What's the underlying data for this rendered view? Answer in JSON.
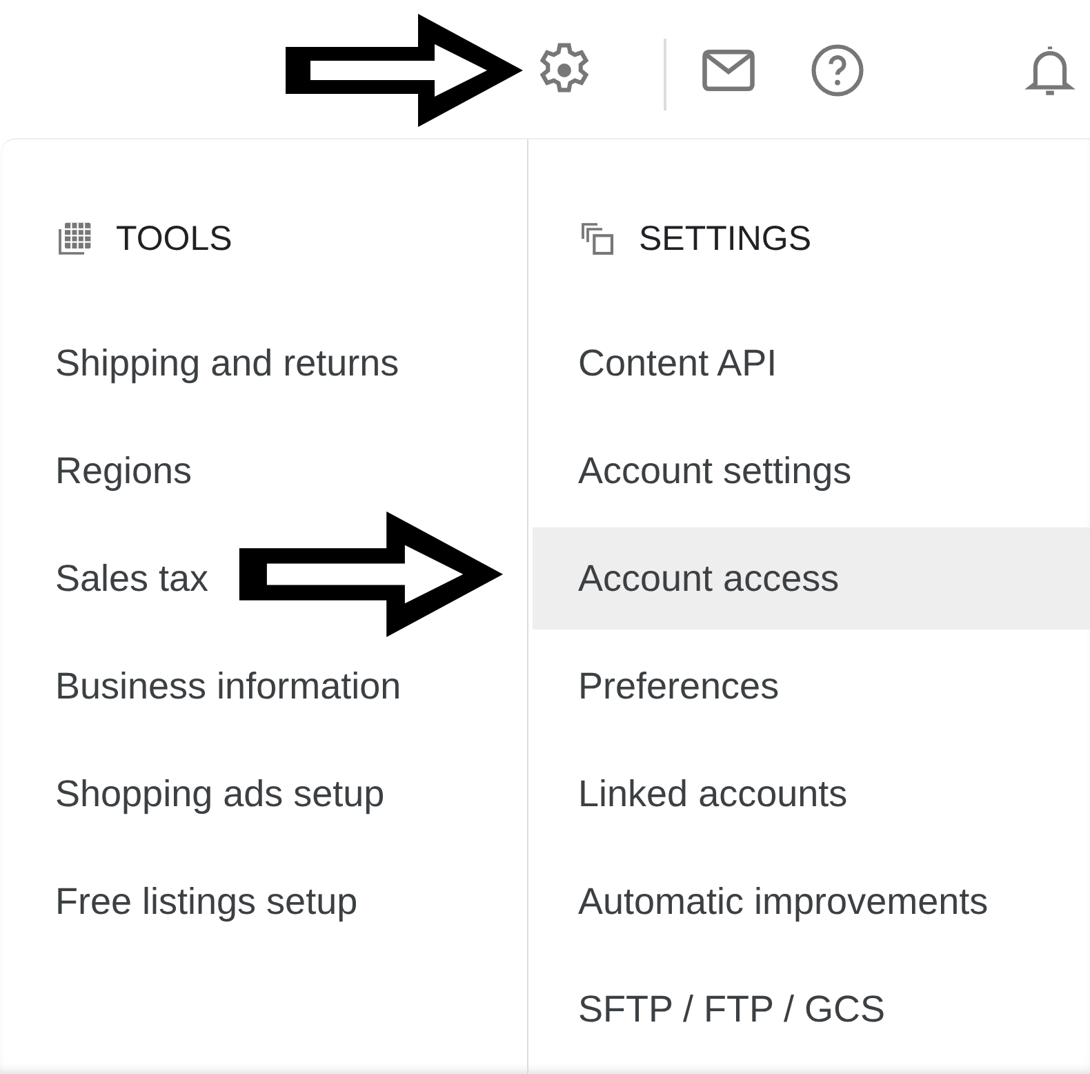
{
  "toolbar": {
    "icons": [
      {
        "kind": "gear"
      },
      {
        "kind": "divider"
      },
      {
        "kind": "mail"
      },
      {
        "kind": "help"
      },
      {
        "kind": "bell"
      }
    ]
  },
  "menu": {
    "sections": [
      {
        "kind": "tools",
        "title": "TOOLS",
        "items": [
          {
            "label": "Shipping and returns",
            "selected": false
          },
          {
            "label": "Regions",
            "selected": false
          },
          {
            "label": "Sales tax",
            "selected": false
          },
          {
            "label": "Business information",
            "selected": false
          },
          {
            "label": "Shopping ads setup",
            "selected": false
          },
          {
            "label": "Free listings setup",
            "selected": false
          }
        ]
      },
      {
        "kind": "settings",
        "title": "SETTINGS",
        "items": [
          {
            "label": "Content API",
            "selected": false
          },
          {
            "label": "Account settings",
            "selected": false
          },
          {
            "label": "Account access",
            "selected": true
          },
          {
            "label": "Preferences",
            "selected": false
          },
          {
            "label": "Linked accounts",
            "selected": false
          },
          {
            "label": "Automatic improvements",
            "selected": false
          },
          {
            "label": "SFTP / FTP / GCS",
            "selected": false
          }
        ]
      }
    ]
  }
}
